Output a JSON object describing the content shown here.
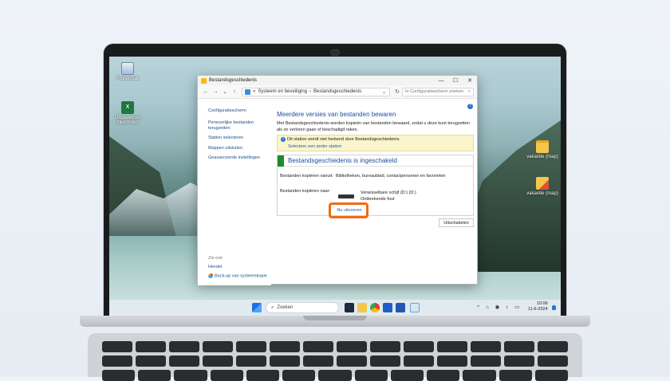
{
  "desktop": {
    "icons_left": [
      {
        "label": "Prullenbak",
        "icon": "recycle-bin-icon"
      },
      {
        "label": "Uitgaven en inkomsten",
        "icon": "excel-file-icon"
      }
    ],
    "icons_right": [
      {
        "label": "vakantie (map)",
        "icon": "folder-icon"
      },
      {
        "label": "vakantie (map)",
        "icon": "folder-image-icon"
      }
    ]
  },
  "window": {
    "title": "Bestandsgeschiedenis",
    "minimize": "—",
    "maximize": "☐",
    "close": "✕",
    "address": {
      "back": "←",
      "forward": "→",
      "dropdown": "⌄",
      "up": "↑",
      "crumb_sep": "«",
      "crumb1": "Systeem en beveiliging",
      "crumb_arrow": "›",
      "crumb2": "Bestandsgeschiedenis",
      "expand": "⌄",
      "refresh": "↻",
      "search_placeholder": "In Configuratiescherm zoeken",
      "search_icon": "⌕"
    },
    "sidebar": {
      "home": "Configuratiescherm",
      "items": [
        "Persoonlijke bestanden terugzetten",
        "Station selecteren",
        "Mappen uitsluiten",
        "Geavanceerde instellingen"
      ],
      "see_also": "Zie ook",
      "restore": "Herstel",
      "backup": "Back-up van systeemkopie"
    },
    "main": {
      "help": "?",
      "heading": "Meerdere versies van bestanden bewaren",
      "description": "Met Bestandsgeschiedenis worden kopieën van bestanden bewaard, zodat u deze kunt terugzetten als ze verloren gaan of beschadigd raken.",
      "warning_icon": "i",
      "warning": "Dit station wordt niet herkend door Bestandsgeschiedenis.",
      "warning_link": "Selecteer een ander station",
      "status_title": "Bestandsgeschiedenis is ingeschakeld",
      "copy_from_label": "Bestanden kopiëren vanuit:",
      "copy_from_value": "Bibliotheken, bureaublad, contactpersonen en favorieten",
      "copy_to_label": "Bestanden kopiëren naar:",
      "drive_name": "Verwisselbare schijf (D:) (D:)",
      "drive_status": "Ontbrekende fout",
      "run_now": "Nu uitvoeren",
      "turn_off": "Uitschakelen"
    }
  },
  "taskbar": {
    "search_label": "Zoeken",
    "search_icon": "⌕",
    "tray": "^ ⌂ ◉ ♪ ▭",
    "time": "10:06",
    "date": "11-6-2024"
  },
  "colors": {
    "highlight": "#f26a13",
    "accent": "#1e4e9a",
    "status_green": "#1e8a2e"
  }
}
